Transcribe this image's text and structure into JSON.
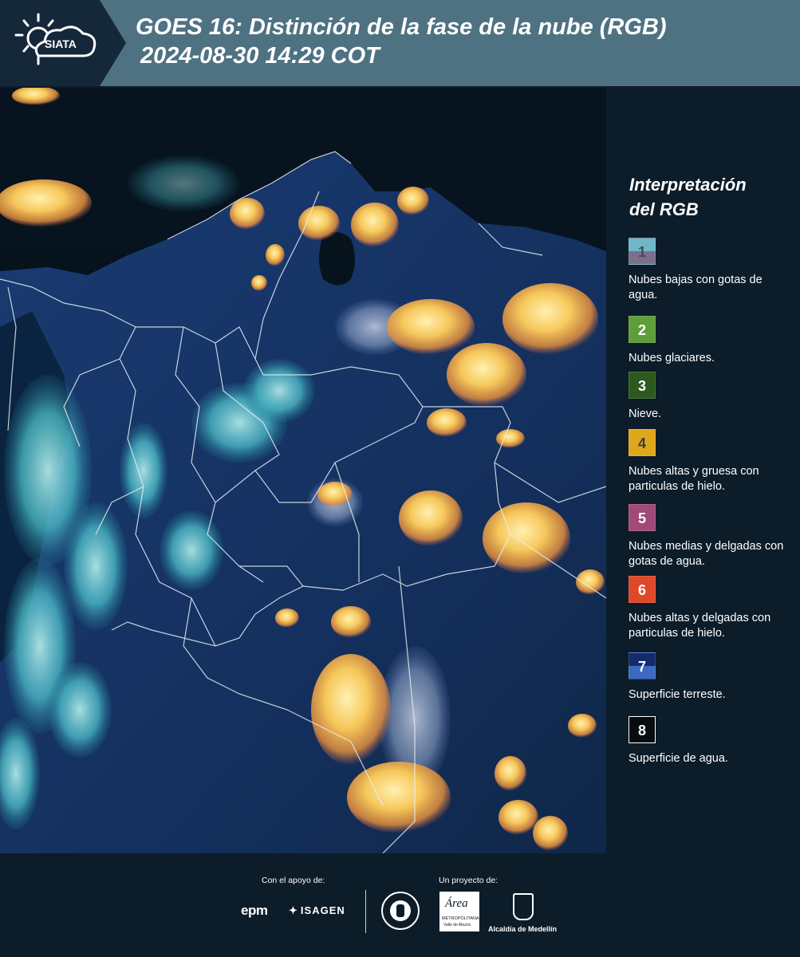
{
  "header": {
    "logo_text": "SIATA",
    "title_line1": "GOES 16: Distinción de la fase de la nube (RGB)",
    "title_line2": "2024-08-30 14:29 COT"
  },
  "legend": {
    "title_line1": "Interpretación",
    "title_line2": "del RGB",
    "items": [
      {
        "num": "1",
        "label": "Nubes bajas con gotas de agua.",
        "color_top": "#6fb7c6",
        "color_bottom": "#7b6f8c",
        "num_color": "#4a4a55"
      },
      {
        "num": "2",
        "label": "Nubes glaciares.",
        "color_top": "#5e9e3a",
        "color_bottom": "#5e9e3a",
        "num_color": "#ffffff"
      },
      {
        "num": "3",
        "label": "Nieve.",
        "color_top": "#2c5a1e",
        "color_bottom": "#2c5a1e",
        "num_color": "#ffffff"
      },
      {
        "num": "4",
        "label": "Nubes altas y gruesa con particulas de hielo.",
        "color_top": "#dfa81c",
        "color_bottom": "#dfa81c",
        "num_color": "#3d3d3d"
      },
      {
        "num": "5",
        "label": "Nubes medias y delgadas con gotas de agua.",
        "color_top": "#a14a7a",
        "color_bottom": "#a14a7a",
        "num_color": "#ffffff"
      },
      {
        "num": "6",
        "label": "Nubes altas y delgadas con particulas de hielo.",
        "color_top": "#e0482a",
        "color_bottom": "#e0482a",
        "num_color": "#ffffff"
      },
      {
        "num": "7",
        "label": "Superficie terreste.",
        "color_top": "#142a6a",
        "color_bottom": "#3c6ac0",
        "num_color": "#ffffff"
      },
      {
        "num": "8",
        "label": "Superficie de agua.",
        "color_top": "#060c10",
        "color_bottom": "#060c10",
        "num_color": "#ffffff"
      }
    ]
  },
  "footer": {
    "support_label": "Con el apoyo de:",
    "project_label": "Un proyecto de:",
    "epm": "epm",
    "isagen": "ISAGEN",
    "area_label": "Área",
    "area_sub": "METROPOLITANA",
    "area_sub2": "Valle de Aburrá",
    "alcaldia": "Alcaldía de Medellín"
  },
  "colors": {
    "header_bg": "#4e7282",
    "page_bg": "#0c1c29",
    "cloud_yellow": "#f5c95a",
    "cloud_cyan": "#7fe3e6"
  }
}
